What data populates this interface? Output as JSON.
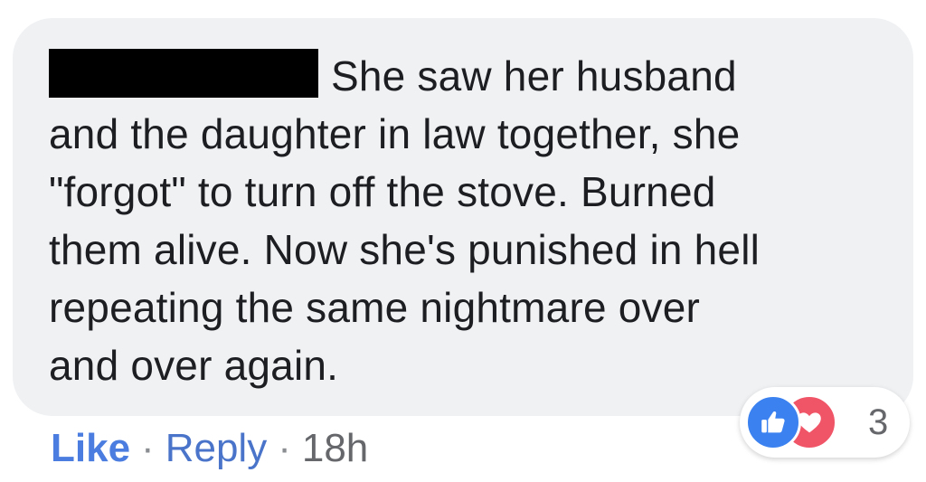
{
  "comment": {
    "author": "",
    "lines": [
      "She saw her husband",
      "and the daughter in law together, she",
      "\"forgot\" to turn off the stove. Burned",
      "them alive. Now she's punished in hell",
      "repeating the same nightmare over",
      "and over again."
    ]
  },
  "reactions": {
    "icons": [
      "like-icon",
      "love-icon"
    ],
    "count": "3",
    "colors": {
      "like": "#3b82f0",
      "love": "#f05467"
    }
  },
  "actions": {
    "like_label": "Like",
    "reply_label": "Reply",
    "separator": "·",
    "timestamp": "18h"
  },
  "colors": {
    "bubble": "#eff1f3",
    "text": "#1c1e21",
    "link": "#4a74c9"
  }
}
